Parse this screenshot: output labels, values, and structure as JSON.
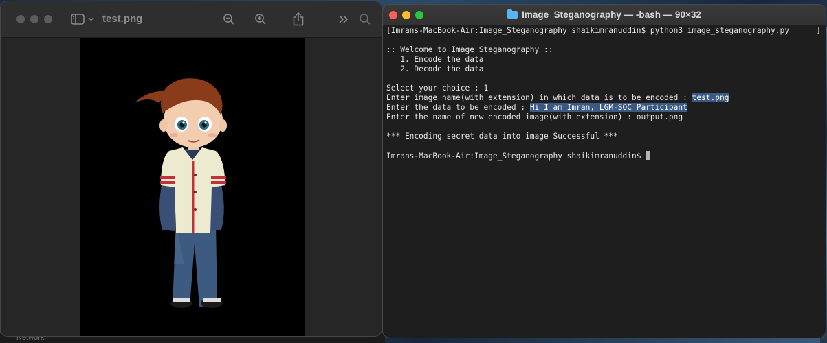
{
  "background": {
    "bottom_label": "Network"
  },
  "preview_window": {
    "title": "test.png",
    "icons": [
      "sidebar-icon",
      "chevron-down-icon",
      "zoom-out-icon",
      "zoom-in-icon",
      "share-icon",
      "more-chevrons-icon",
      "search-icon"
    ],
    "image_description_icon": "cartoon-boy-image"
  },
  "terminal": {
    "title": "Image_Steganography — -bash — 90×32",
    "colors": {
      "background": "#1e1e1e",
      "text": "#e6e6e6",
      "highlight": "#3a5a83"
    },
    "lines": {
      "l1": "[Imrans-MacBook-Air:Image_Steganography shaikimranuddin$ python3 image_steganography.py",
      "l1_tail": "]",
      "l2": "",
      "l3": ":: Welcome to Image Steganography ::",
      "l4": "   1. Encode the data",
      "l5": "   2. Decode the data",
      "l6": "",
      "l7": "Select your choice : 1",
      "l8_prefix": "Enter image name(with extension) in which data is to be encoded : ",
      "l8_value": "test.png",
      "l9_prefix": "Enter the data to be encoded : ",
      "l9_value": "Hi I am Imran, LGM-SOC Participant",
      "l10": "Enter the name of new encoded image(with extension) : output.png",
      "l11": "",
      "l12": "*** Encoding secret data into image Successful ***",
      "l13": "",
      "l14_prompt": "Imrans-MacBook-Air:Image_Steganography shaikimranuddin$ "
    }
  }
}
